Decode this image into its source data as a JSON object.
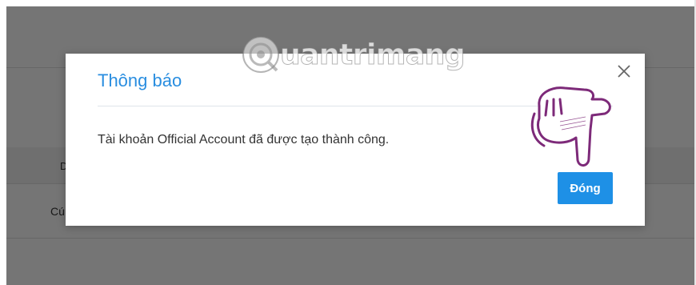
{
  "background": {
    "row_label_1": "D",
    "row_label_2": "Cú"
  },
  "modal": {
    "title": "Thông báo",
    "message": "Tài khoản Official Account đã được tạo thành công.",
    "close_icon": "close-icon",
    "button_label": "Đóng"
  },
  "watermark": {
    "text": "uantrimang",
    "icon": "quantrimang-logo"
  },
  "annotation": {
    "icon": "pointing-hand-icon"
  },
  "colors": {
    "accent": "#1e90e6",
    "title": "#2a8ee0",
    "hand": "#7d2a79"
  }
}
